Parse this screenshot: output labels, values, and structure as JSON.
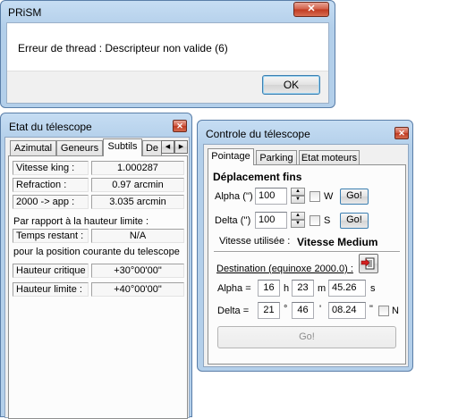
{
  "error_dialog": {
    "title": "PRiSM",
    "close_glyph": "✕",
    "message": "Erreur de thread : Descripteur non valide (6)",
    "ok_label": "OK"
  },
  "etat_window": {
    "title": "Etat du télescope",
    "close_glyph": "✕",
    "tabs": [
      {
        "label": "Azimutal"
      },
      {
        "label": "Geneurs"
      },
      {
        "label": "Subtils"
      },
      {
        "label": "De"
      }
    ],
    "tab_scroll_left": "◀",
    "tab_scroll_right": "▶",
    "vitesse_king": {
      "label": "Vitesse king :",
      "value": "1.000287"
    },
    "refraction": {
      "label": "Refraction :",
      "value": "0.97 arcmin"
    },
    "app": {
      "label": "2000 -> app :",
      "value": "3.035 arcmin"
    },
    "par_rapport": "Par rapport à la hauteur limite :",
    "temps_restant": {
      "label": "Temps restant :",
      "value": "N/A"
    },
    "position_courante": "pour la position courante du telescope",
    "hauteur_critique": {
      "label": "Hauteur critique :",
      "value": "+30°00'00\""
    },
    "hauteur_limite": {
      "label": "Hauteur limite :",
      "value": "+40°00'00\""
    }
  },
  "controle_window": {
    "title": "Controle du télescope",
    "close_glyph": "✕",
    "tabs": [
      {
        "label": "Pointage"
      },
      {
        "label": "Parking"
      },
      {
        "label": "Etat moteurs"
      }
    ],
    "deplacement_title": "Déplacement fins",
    "alpha_label": "Alpha ('')",
    "alpha_value": "100",
    "alpha_check_label": "W",
    "delta_label": "Delta ('')",
    "delta_value": "100",
    "delta_check_label": "S",
    "go_label": "Go!",
    "vitesse_label": "Vitesse utilisée :",
    "vitesse_value": "Vitesse Medium",
    "destination_label": "Destination (equinoxe 2000.0) :",
    "dest_alpha": {
      "label": "Alpha =",
      "h": "16",
      "h_unit": "h",
      "m": "23",
      "m_unit": "m",
      "s": "45.26",
      "s_unit": "s"
    },
    "dest_delta": {
      "label": "Delta =",
      "d": "21",
      "d_unit": "°",
      "m": "46",
      "m_unit": "'",
      "s": "08.24",
      "s_unit": "\"",
      "check_label": "N"
    },
    "go_big_label": "Go!"
  }
}
